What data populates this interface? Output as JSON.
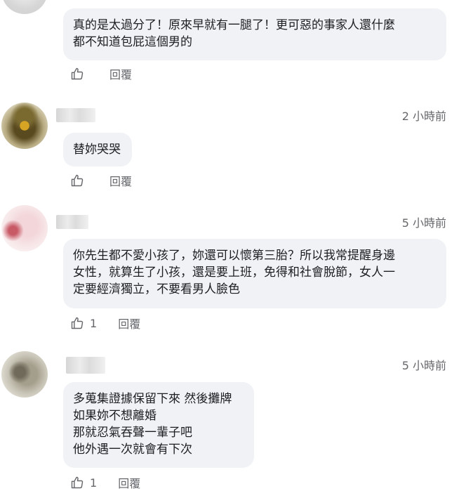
{
  "comments": [
    {
      "time": "",
      "lines": [
        "真的是太過分了！原來早就有一腿了！更可惡的事家人還什麼",
        "都不知道包屁這個男的"
      ],
      "like_count": "",
      "reply_label": "回覆"
    },
    {
      "time": "2 小時前",
      "lines": [
        "替妳哭哭"
      ],
      "like_count": "",
      "reply_label": "回覆"
    },
    {
      "time": "5 小時前",
      "lines": [
        "你先生都不愛小孩了，妳還可以懷第三胎？所以我常提醒身邊",
        "女性，就算生了小孩，還是要上班，免得和社會脫節，女人一",
        "定要經濟獨立，不要看男人臉色"
      ],
      "like_count": "1",
      "reply_label": "回覆"
    },
    {
      "time": "5 小時前",
      "lines": [
        "多蒐集證據保留下來 然後攤牌",
        "如果妳不想離婚",
        "那就忍氣吞聲一輩子吧",
        "他外遇一次就會有下次"
      ],
      "like_count": "1",
      "reply_label": "回覆"
    }
  ],
  "icons": {
    "like": "thumbs-up-icon"
  },
  "colors": {
    "bubble": "#f0f2f5",
    "meta_text": "#65676b"
  }
}
